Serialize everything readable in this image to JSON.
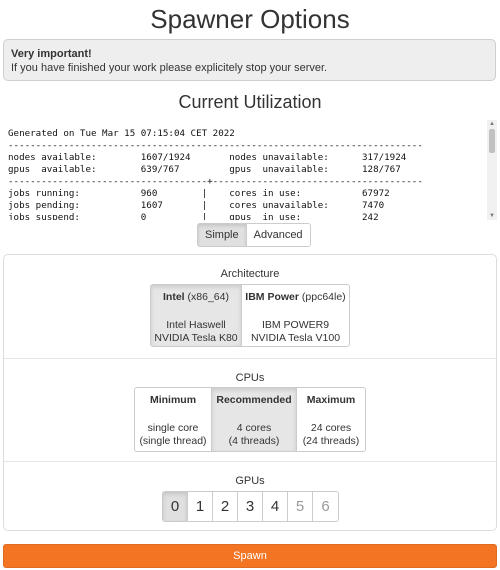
{
  "page": {
    "title": "Spawner Options"
  },
  "alert": {
    "heading": "Very important!",
    "message": "If you have finished your work please explicitely stop your server."
  },
  "utilization": {
    "title": "Current Utilization",
    "report": "Generated on Tue Mar 15 07:15:04 CET 2022\n---------------------------------------------------------------------------\nnodes available:        1607/1924       nodes unavailable:      317/1924\ngpus  available:        639/767         gpus  unavailable:      128/767\n------------------------------------+--------------------------------------\njobs running:           960        |    cores in use:           67972\njobs pending:           1607       |    cores unavailable:      7470\njobs suspend:           0          |    gpus  in use:           242"
  },
  "mode": {
    "options": [
      "Simple",
      "Advanced"
    ],
    "selected": "Simple"
  },
  "architecture": {
    "label": "Architecture",
    "options": [
      {
        "title": "Intel",
        "suffix": "(x86_64)",
        "line1": "Intel Haswell",
        "line2": "NVIDIA Tesla K80",
        "selected": true
      },
      {
        "title": "IBM Power",
        "suffix": "(ppc64le)",
        "line1": "IBM POWER9",
        "line2": "NVIDIA Tesla V100",
        "selected": false
      }
    ]
  },
  "cpus": {
    "label": "CPUs",
    "options": [
      {
        "title": "Minimum",
        "line1": "single core",
        "line2": "(single thread)",
        "selected": false
      },
      {
        "title": "Recommended",
        "line1": "4 cores",
        "line2": "(4 threads)",
        "selected": true
      },
      {
        "title": "Maximum",
        "line1": "24 cores",
        "line2": "(24 threads)",
        "selected": false
      }
    ]
  },
  "gpus": {
    "label": "GPUs",
    "options": [
      "0",
      "1",
      "2",
      "3",
      "4",
      "5",
      "6"
    ],
    "selected": "0",
    "disabled": [
      "5",
      "6"
    ]
  },
  "spawn": {
    "label": "Spawn"
  },
  "colors": {
    "accent": "#f37524",
    "alert_bg": "#eeeeee",
    "selected_bg": "#e6e6e6"
  }
}
